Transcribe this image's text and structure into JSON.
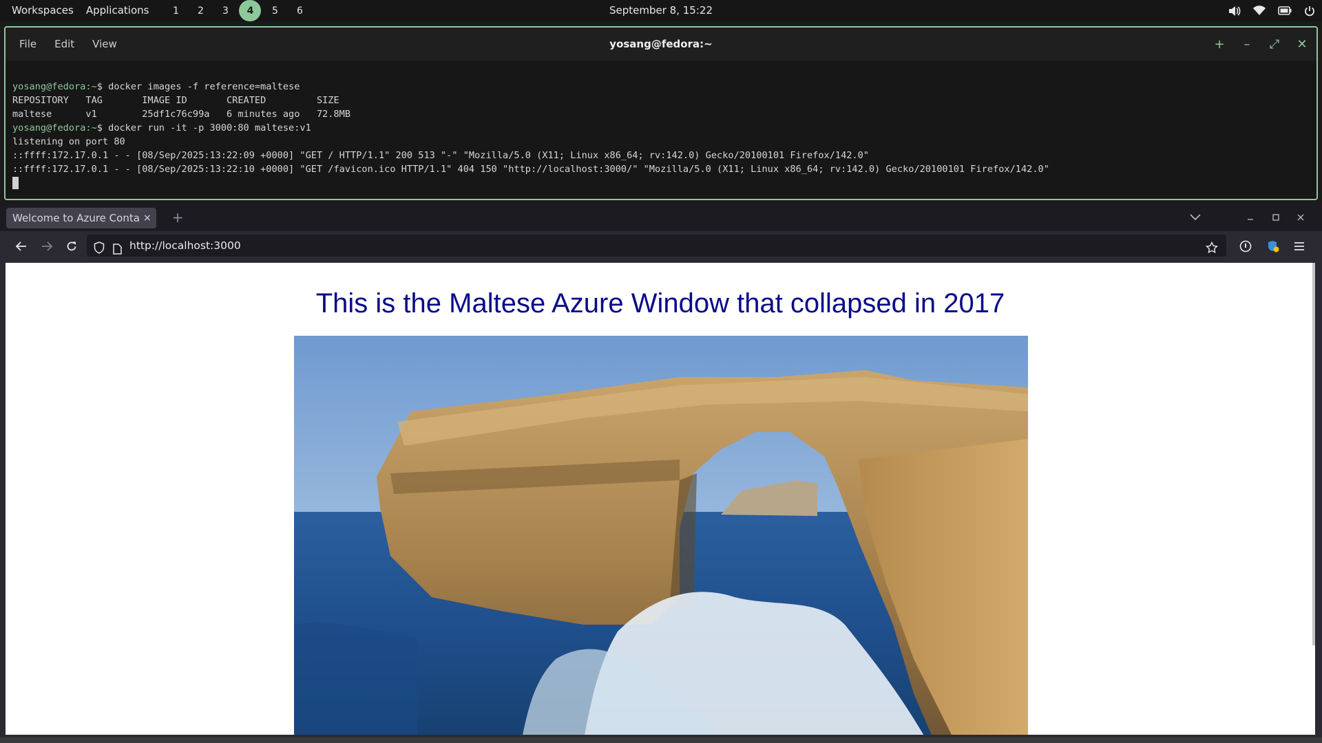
{
  "topbar": {
    "workspaces_label": "Workspaces",
    "applications_label": "Applications",
    "workspaces": [
      "1",
      "2",
      "3",
      "4",
      "5",
      "6"
    ],
    "active_workspace": "4",
    "clock": "September 8, 15:22",
    "tray_icons": [
      "volume-icon",
      "wifi-icon",
      "battery-icon",
      "power-icon"
    ],
    "accent_color": "#8dc89a"
  },
  "terminal": {
    "menu": [
      "File",
      "Edit",
      "View"
    ],
    "title": "yosang@fedora:~",
    "controls": [
      "+",
      "–",
      "⤢",
      "✕"
    ],
    "lines": [
      {
        "prompt": "yosang@fedora:~",
        "text": "$ docker images -f reference=maltese"
      },
      {
        "prompt": "",
        "text": "REPOSITORY   TAG       IMAGE ID       CREATED         SIZE"
      },
      {
        "prompt": "",
        "text": "maltese      v1        25df1c76c99a   6 minutes ago   72.8MB"
      },
      {
        "prompt": "yosang@fedora:~",
        "text": "$ docker run -it -p 3000:80 maltese:v1"
      },
      {
        "prompt": "",
        "text": "listening on port 80"
      },
      {
        "prompt": "",
        "text": "::ffff:172.17.0.1 - - [08/Sep/2025:13:22:09 +0000] \"GET / HTTP/1.1\" 200 513 \"-\" \"Mozilla/5.0 (X11; Linux x86_64; rv:142.0) Gecko/20100101 Firefox/142.0\""
      },
      {
        "prompt": "",
        "text": "::ffff:172.17.0.1 - - [08/Sep/2025:13:22:10 +0000] \"GET /favicon.ico HTTP/1.1\" 404 150 \"http://localhost:3000/\" \"Mozilla/5.0 (X11; Linux x86_64; rv:142.0) Gecko/20100101 Firefox/142.0\""
      }
    ]
  },
  "browser": {
    "tab_title": "Welcome to Azure Container",
    "tab_close": "×",
    "new_tab": "+",
    "url": "http://localhost:3000",
    "page": {
      "heading": "This is the Maltese Azure Window that collapsed in 2017"
    }
  }
}
